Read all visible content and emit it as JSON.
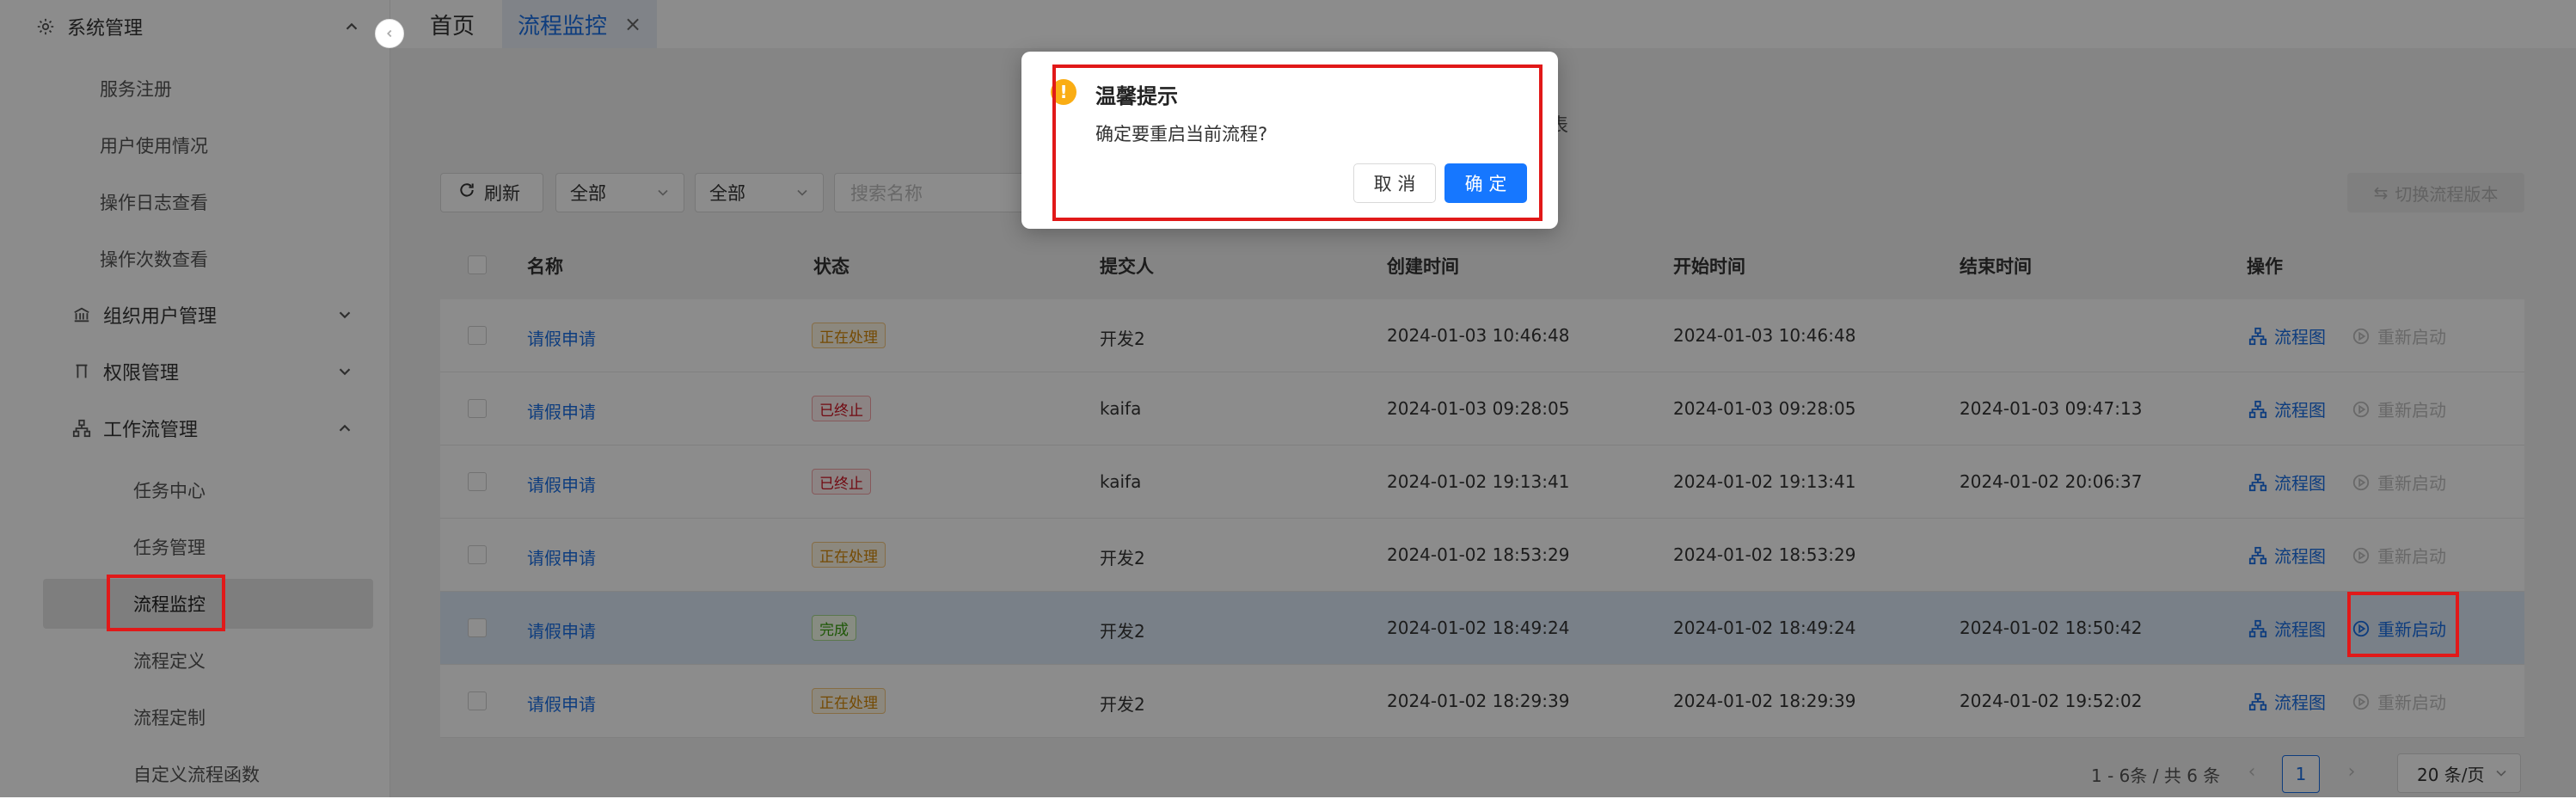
{
  "sidebar": {
    "system_group": {
      "label": "系统管理"
    },
    "system_items": [
      "服务注册",
      "用户使用情况",
      "操作日志查看",
      "操作次数查看"
    ],
    "org_group": {
      "label": "组织用户管理"
    },
    "perm_group": {
      "label": "权限管理"
    },
    "workflow_group": {
      "label": "工作流管理"
    },
    "workflow_items": [
      "任务中心",
      "任务管理",
      "流程监控",
      "流程定义",
      "流程定制",
      "自定义流程函数"
    ],
    "active_item": "流程监控"
  },
  "tabs": [
    {
      "label": "首页"
    },
    {
      "label": "流程监控",
      "close": "×"
    }
  ],
  "background_title_fragment": "表",
  "toolbar": {
    "refresh_label": "刷新",
    "filter1_value": "全部",
    "filter2_value": "全部",
    "search_placeholder": "搜索名称",
    "switch_version_label": "切换流程版本"
  },
  "table": {
    "columns": [
      "名称",
      "状态",
      "提交人",
      "创建时间",
      "开始时间",
      "结束时间",
      "操作"
    ],
    "rows": [
      {
        "name": "请假申请",
        "status": "正在处理",
        "status_type": "processing",
        "submitter": "开发2",
        "created": "2024-01-03 10:46:48",
        "started": "2024-01-03 10:46:48",
        "ended": "",
        "op_flow": "流程图",
        "op_restart": "重新启动"
      },
      {
        "name": "请假申请",
        "status": "已终止",
        "status_type": "stopped",
        "submitter": "kaifa",
        "created": "2024-01-03 09:28:05",
        "started": "2024-01-03 09:28:05",
        "ended": "2024-01-03 09:47:13",
        "op_flow": "流程图",
        "op_restart": "重新启动"
      },
      {
        "name": "请假申请",
        "status": "已终止",
        "status_type": "stopped",
        "submitter": "kaifa",
        "created": "2024-01-02 19:13:41",
        "started": "2024-01-02 19:13:41",
        "ended": "2024-01-02 20:06:37",
        "op_flow": "流程图",
        "op_restart": "重新启动"
      },
      {
        "name": "请假申请",
        "status": "正在处理",
        "status_type": "processing",
        "submitter": "开发2",
        "created": "2024-01-02 18:53:29",
        "started": "2024-01-02 18:53:29",
        "ended": "",
        "op_flow": "流程图",
        "op_restart": "重新启动"
      },
      {
        "name": "请假申请",
        "status": "完成",
        "status_type": "done",
        "submitter": "开发2",
        "created": "2024-01-02 18:49:24",
        "started": "2024-01-02 18:49:24",
        "ended": "2024-01-02 18:50:42",
        "op_flow": "流程图",
        "op_restart": "重新启动"
      },
      {
        "name": "请假申请",
        "status": "正在处理",
        "status_type": "processing",
        "submitter": "开发2",
        "created": "2024-01-02 18:29:39",
        "started": "2024-01-02 18:29:39",
        "ended": "2024-01-02 19:52:02",
        "op_flow": "流程图",
        "op_restart": "重新启动"
      }
    ]
  },
  "pagination": {
    "total_text": "1 - 6条 / 共 6 条",
    "current_page": "1",
    "page_size": "20 条/页"
  },
  "modal": {
    "title": "温馨提示",
    "content": "确定要重启当前流程?",
    "cancel_label": "取 消",
    "ok_label": "确 定"
  },
  "colors": {
    "primary": "#1677ff",
    "warning": "#faad14",
    "annotation": "#e11919"
  }
}
